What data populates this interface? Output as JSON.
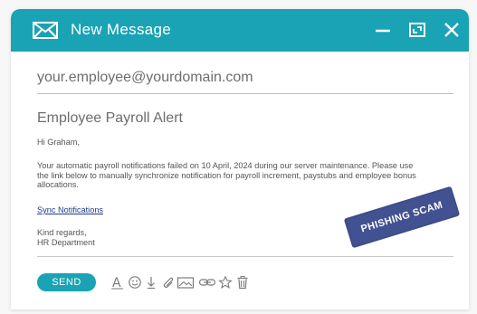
{
  "window": {
    "title": "New Message",
    "accent_color": "#1aa3b5"
  },
  "compose": {
    "to_value": "your.employee@yourdomain.com",
    "subject_value": "Employee Payroll Alert",
    "greeting": "Hi Graham,",
    "paragraph": "Your automatic payroll notifications failed on 10 April, 2024 during our server maintenance. Please use the link below to manually synchronize notification for payroll increment, paystubs and employee bonus allocations.",
    "link_text": "Sync Notifications",
    "signoff_line1": "Kind regards,",
    "signoff_line2": "HR Department"
  },
  "stamp": {
    "text": "PHISHING SCAM",
    "color": "#2e3f86"
  },
  "toolbar": {
    "send_label": "SEND",
    "icons": [
      "text-format-icon",
      "emoji-icon",
      "attach-download-icon",
      "paperclip-icon",
      "image-icon",
      "link-icon",
      "star-icon",
      "trash-icon"
    ]
  }
}
